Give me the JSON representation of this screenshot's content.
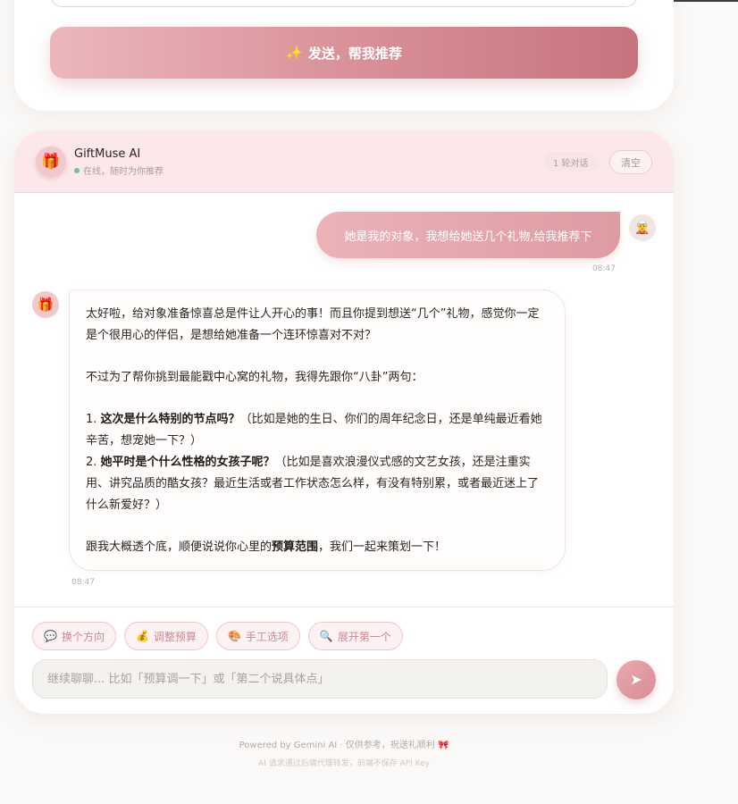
{
  "colors": {
    "accent": "#d88e96",
    "online": "#6fc38e",
    "page_bg": "#faf9f7"
  },
  "form": {
    "submit_icon": "sparkles-icon",
    "submit_glyph": "✨",
    "submit_label": "发送，帮我推荐"
  },
  "chat": {
    "header": {
      "avatar_icon": "gift-icon",
      "avatar_glyph": "🎁",
      "name": "GiftMuse AI",
      "status": "在线，随时为你推荐",
      "rounds": "1 轮对话",
      "clear_label": "清空"
    },
    "messages": [
      {
        "role": "user",
        "avatar_glyph": "🧝",
        "text": "她是我的对象，我想给她送几个礼物,给我推荐下",
        "time": "08:47"
      },
      {
        "role": "assistant",
        "avatar_glyph": "🎁",
        "time": "08:47",
        "p1": "太好啦，给对象准备惊喜总是件让人开心的事！而且你提到想送“几个”礼物，感觉你一定是个很用心的伴侣，是想给她准备一个连环惊喜对不对？",
        "p2": "不过为了帮你挑到最能戳中心窝的礼物，我得先跟你“八卦”两句：",
        "q1_num": "1. ",
        "q1_bold": "这次是什么特别的节点吗？",
        "q1_rest": "（比如是她的生日、你们的周年纪念日，还是单纯最近看她辛苦，想宠她一下？）",
        "q2_num": "2. ",
        "q2_bold": "她平时是个什么性格的女孩子呢？",
        "q2_rest": "（比如是喜欢浪漫仪式感的文艺女孩，还是注重实用、讲究品质的酷女孩？最近生活或者工作状态怎么样，有没有特别累，或者最近迷上了什么新爱好？）",
        "p3_a": "跟我大概透个底，顺便说说你心里的",
        "p3_bold": "预算范围",
        "p3_b": "，我们一起来策划一下！"
      }
    ],
    "chips": [
      {
        "icon": "speech-bubble-icon",
        "glyph": "💬",
        "label": "换个方向"
      },
      {
        "icon": "money-bag-icon",
        "glyph": "💰",
        "label": "调整预算"
      },
      {
        "icon": "yarn-icon",
        "glyph": "🎨",
        "label": "手工选项"
      },
      {
        "icon": "magnifier-icon",
        "glyph": "🔍",
        "label": "展开第一个"
      }
    ],
    "input_placeholder": "继续聊聊... 比如「预算调一下」或「第二个说具体点」",
    "send_icon": "paper-plane-icon",
    "send_glyph": "➤"
  },
  "footer": {
    "line1": "Powered by Gemini AI · 仅供参考，祝送礼顺利 🎀",
    "line2": "AI 请求通过后端代理转发，前端不保存 API Key"
  }
}
